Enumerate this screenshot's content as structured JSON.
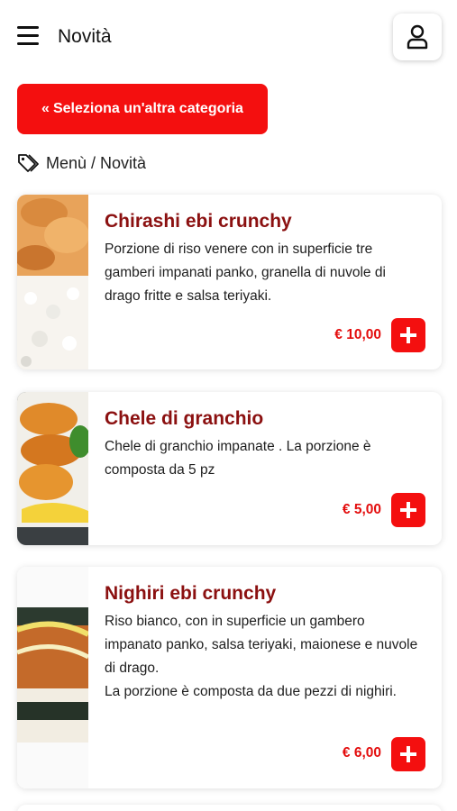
{
  "header": {
    "title": "Novità",
    "menu_icon": "hamburger-menu-icon",
    "user_icon": "user-icon"
  },
  "back_button": {
    "icon": "double-chevron-left-icon",
    "label": "Seleziona un'altra categoria"
  },
  "breadcrumb": {
    "icon": "tags-icon",
    "text": "Menù / Novità"
  },
  "colors": {
    "accent": "#f40f0f",
    "product_name": "#8b1010",
    "price": "#e30d0d"
  },
  "products": [
    {
      "name": "Chirashi ebi crunchy",
      "description": "Porzione di riso venere con in superficie tre gamberi impanati panko, granella di nuvole di drago fritte e salsa teriyaki.",
      "price": "€ 10,00",
      "add_icon": "plus-icon"
    },
    {
      "name": "Chele di granchio",
      "description": "Chele di granchio impanate . La porzione è composta da 5 pz",
      "price": "€ 5,00",
      "add_icon": "plus-icon"
    },
    {
      "name": "Nighiri ebi crunchy",
      "description": "Riso bianco, con in superficie un gambero impanato panko, salsa teriyaki, maionese e nuvole di drago.\nLa porzione è composta da due pezzi di nighiri.",
      "price": "€ 6,00",
      "add_icon": "plus-icon"
    }
  ]
}
